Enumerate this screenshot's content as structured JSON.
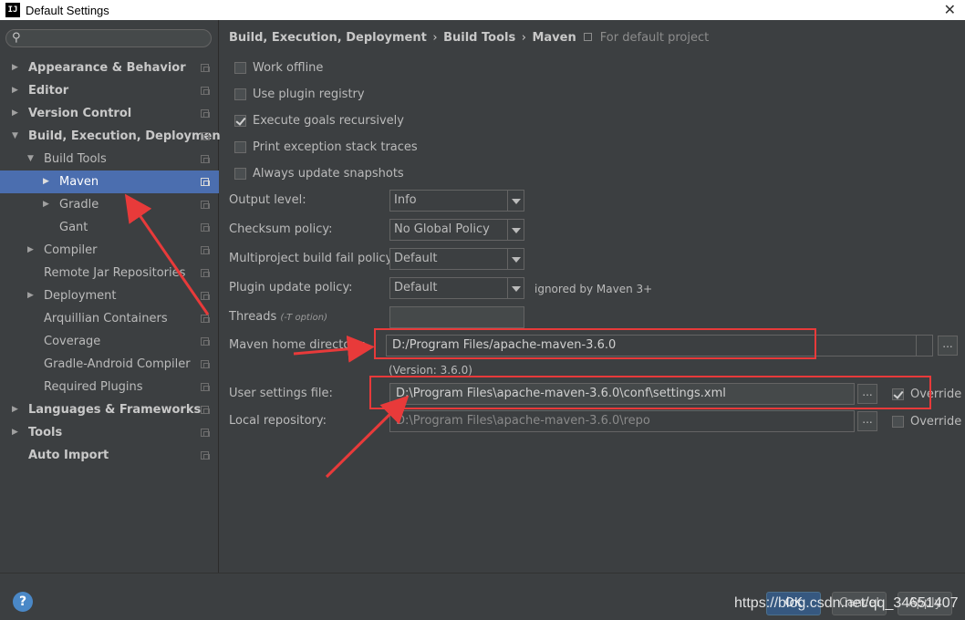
{
  "window": {
    "title": "Default Settings",
    "app_icon": "IJ"
  },
  "sidebar": {
    "search_placeholder": "",
    "items": [
      {
        "label": "Appearance & Behavior",
        "bold": true,
        "arrow": "▶",
        "indent": 0
      },
      {
        "label": "Editor",
        "bold": true,
        "arrow": "▶",
        "indent": 0
      },
      {
        "label": "Version Control",
        "bold": true,
        "arrow": "▶",
        "indent": 0
      },
      {
        "label": "Build, Execution, Deployment",
        "bold": true,
        "arrow": "▼",
        "indent": 0
      },
      {
        "label": "Build Tools",
        "bold": false,
        "arrow": "▼",
        "indent": 1
      },
      {
        "label": "Maven",
        "bold": false,
        "arrow": "▶",
        "indent": 2,
        "selected": true
      },
      {
        "label": "Gradle",
        "bold": false,
        "arrow": "▶",
        "indent": 2
      },
      {
        "label": "Gant",
        "bold": false,
        "arrow": "",
        "indent": 2
      },
      {
        "label": "Compiler",
        "bold": false,
        "arrow": "▶",
        "indent": 1
      },
      {
        "label": "Remote Jar Repositories",
        "bold": false,
        "arrow": "",
        "indent": 1
      },
      {
        "label": "Deployment",
        "bold": false,
        "arrow": "▶",
        "indent": 1
      },
      {
        "label": "Arquillian Containers",
        "bold": false,
        "arrow": "",
        "indent": 1
      },
      {
        "label": "Coverage",
        "bold": false,
        "arrow": "",
        "indent": 1
      },
      {
        "label": "Gradle-Android Compiler",
        "bold": false,
        "arrow": "",
        "indent": 1
      },
      {
        "label": "Required Plugins",
        "bold": false,
        "arrow": "",
        "indent": 1
      },
      {
        "label": "Languages & Frameworks",
        "bold": true,
        "arrow": "▶",
        "indent": 0
      },
      {
        "label": "Tools",
        "bold": true,
        "arrow": "▶",
        "indent": 0
      },
      {
        "label": "Auto Import",
        "bold": true,
        "arrow": "",
        "indent": 0
      }
    ]
  },
  "breadcrumb": {
    "part1": "Build, Execution, Deployment",
    "sep": "›",
    "part2": "Build Tools",
    "part3": "Maven",
    "project_note": "For default project"
  },
  "checkboxes": {
    "work_offline": {
      "label": "Work offline",
      "checked": false
    },
    "plugin_registry": {
      "label": "Use plugin registry",
      "checked": false
    },
    "goals_recursive": {
      "label": "Execute goals recursively",
      "checked": true
    },
    "stack_traces": {
      "label": "Print exception stack traces",
      "checked": false
    },
    "update_snapshots": {
      "label": "Always update snapshots",
      "checked": false
    }
  },
  "settings": {
    "output_level": {
      "label": "Output level:",
      "value": "Info"
    },
    "checksum_policy": {
      "label": "Checksum policy:",
      "value": "No Global Policy"
    },
    "fail_policy": {
      "label": "Multiproject build fail policy:",
      "value": "Default"
    },
    "plugin_update": {
      "label": "Plugin update policy:",
      "value": "Default",
      "note": "ignored by Maven 3+"
    },
    "threads": {
      "label": "Threads",
      "hint": "(-T option)",
      "value": ""
    },
    "maven_home": {
      "label": "Maven home directory:",
      "value": "D:/Program Files/apache-maven-3.6.0",
      "version": "(Version: 3.6.0)"
    },
    "user_settings": {
      "label": "User settings file:",
      "value": "D:\\Program Files\\apache-maven-3.6.0\\conf\\settings.xml",
      "override_label": "Override",
      "override": true
    },
    "local_repo": {
      "label": "Local repository:",
      "value": "D:\\Program Files\\apache-maven-3.6.0\\repo",
      "override_label": "Override",
      "override": false
    },
    "browse_label": "..."
  },
  "footer": {
    "help": "?",
    "ok": "OK",
    "cancel": "Cancel",
    "apply": "Apply",
    "watermark": "https://blog.csdn.net/qq_34651407"
  },
  "colors": {
    "accent_selection": "#4b6eaf",
    "annotation_red": "#e83a3a",
    "background": "#3c3f41"
  }
}
